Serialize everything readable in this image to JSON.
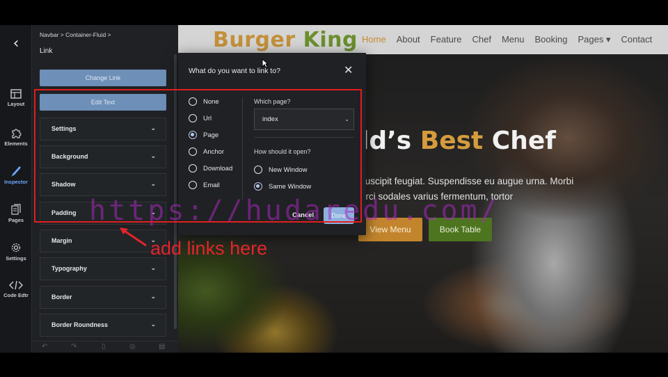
{
  "rail": {
    "items": [
      {
        "label": "Layout",
        "icon": "layout-icon"
      },
      {
        "label": "Elements",
        "icon": "puzzle-icon"
      },
      {
        "label": "Inspector",
        "icon": "brush-icon"
      },
      {
        "label": "Pages",
        "icon": "pages-icon"
      },
      {
        "label": "Settings",
        "icon": "gear-icon"
      },
      {
        "label": "Code Edtr",
        "icon": "code-icon"
      }
    ]
  },
  "panel": {
    "breadcrumb": "Navbar > Container-Fluid >",
    "title": "Link",
    "change_link": "Change Link",
    "edit_text": "Edit Text",
    "sections": [
      "Settings",
      "Background",
      "Shadow",
      "Padding",
      "Margin",
      "Typography",
      "Border",
      "Border Roundness"
    ]
  },
  "site": {
    "brand_a": "Burger",
    "brand_b": "King",
    "nav": [
      "Home",
      "About",
      "Feature",
      "Chef",
      "Menu",
      "Booking",
      "Pages ▾",
      "Contact"
    ],
    "active_nav": "Home",
    "hero_title_a": "ld’s ",
    "hero_title_accent": "Best",
    "hero_title_b": " Chef",
    "hero_line1": "suscipit feugiat. Suspendisse eu augue urna. Morbi",
    "hero_line2": "orci sodales varius fermentum, tortor",
    "btn_menu": "View Menu",
    "btn_book": "Book Table"
  },
  "modal": {
    "title": "What do you want to link to?",
    "options": [
      {
        "label": "None",
        "checked": false
      },
      {
        "label": "Url",
        "checked": false
      },
      {
        "label": "Page",
        "checked": true
      },
      {
        "label": "Anchor",
        "checked": false
      },
      {
        "label": "Download",
        "checked": false
      },
      {
        "label": "Email",
        "checked": false
      }
    ],
    "which_page_label": "Which page?",
    "which_page_value": "index",
    "open_label": "How should it open?",
    "open_options": [
      {
        "label": "New Window",
        "checked": false
      },
      {
        "label": "Same Window",
        "checked": true
      }
    ],
    "cancel": "Cancel",
    "done": "Done"
  },
  "annotation": {
    "text": "add links here",
    "watermark": "https://hudaredu.com/"
  },
  "colors": {
    "annotation_red": "#e21d1d",
    "brand_gold": "#c4903a",
    "brand_green": "#6b8f2d",
    "accent_blue": "#6d8fb8"
  }
}
